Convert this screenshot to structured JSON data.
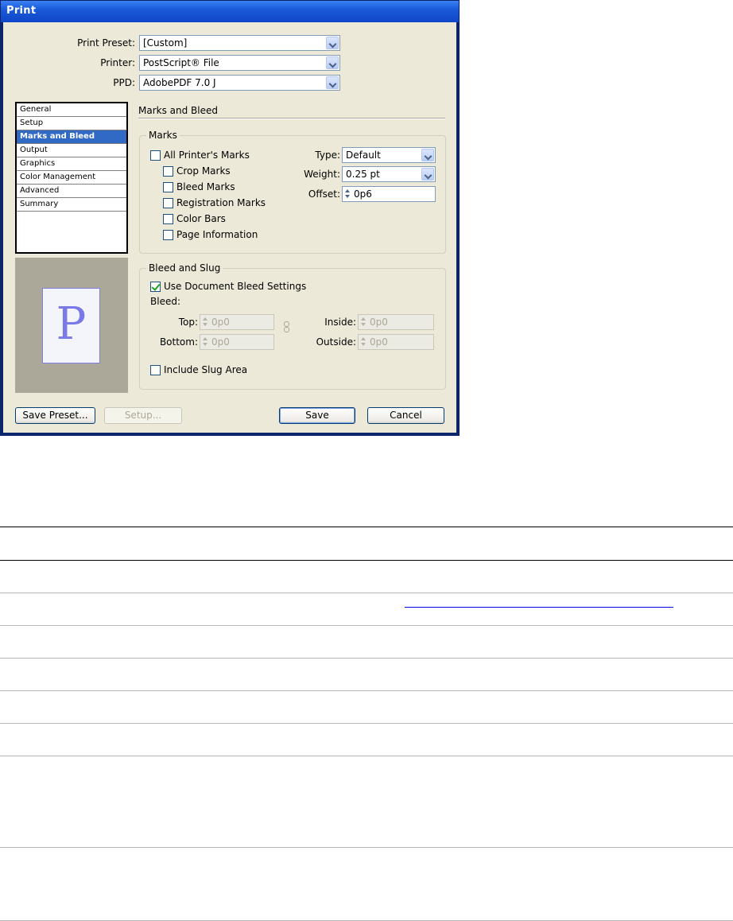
{
  "window": {
    "title": "Print"
  },
  "top_fields": {
    "print_preset": {
      "label": "Print Preset:",
      "value": "[Custom]"
    },
    "printer": {
      "label": "Printer:",
      "value": "PostScript® File"
    },
    "ppd": {
      "label": "PPD:",
      "value": "AdobePDF 7.0 J"
    }
  },
  "nav": {
    "items": [
      "General",
      "Setup",
      "Marks and Bleed",
      "Output",
      "Graphics",
      "Color Management",
      "Advanced",
      "Summary"
    ],
    "selected": "Marks and Bleed"
  },
  "preview": {
    "glyph": "P"
  },
  "section_title": "Marks and Bleed",
  "marks": {
    "group_label": "Marks",
    "all_printers_marks": "All Printer's Marks",
    "crop_marks": "Crop Marks",
    "bleed_marks": "Bleed Marks",
    "registration_marks": "Registration Marks",
    "color_bars": "Color Bars",
    "page_information": "Page Information",
    "type": {
      "label": "Type:",
      "value": "Default"
    },
    "weight": {
      "label": "Weight:",
      "value": "0.25 pt"
    },
    "offset": {
      "label": "Offset:",
      "value": "0p6"
    }
  },
  "bleed_slug": {
    "group_label": "Bleed and Slug",
    "use_document_bleed": "Use Document Bleed Settings",
    "bleed_label": "Bleed:",
    "top": {
      "label": "Top:",
      "value": "0p0"
    },
    "bottom": {
      "label": "Bottom:",
      "value": "0p0"
    },
    "inside": {
      "label": "Inside:",
      "value": "0p0"
    },
    "outside": {
      "label": "Outside:",
      "value": "0p0"
    },
    "include_slug": "Include Slug Area"
  },
  "buttons": {
    "save_preset": "Save Preset...",
    "setup": "Setup...",
    "save": "Save",
    "cancel": "Cancel"
  },
  "colors": {
    "titlebar": "#1a5ad9",
    "dialog_bg": "#ece9d8",
    "selection": "#316ac5",
    "link": "#0000ee"
  }
}
